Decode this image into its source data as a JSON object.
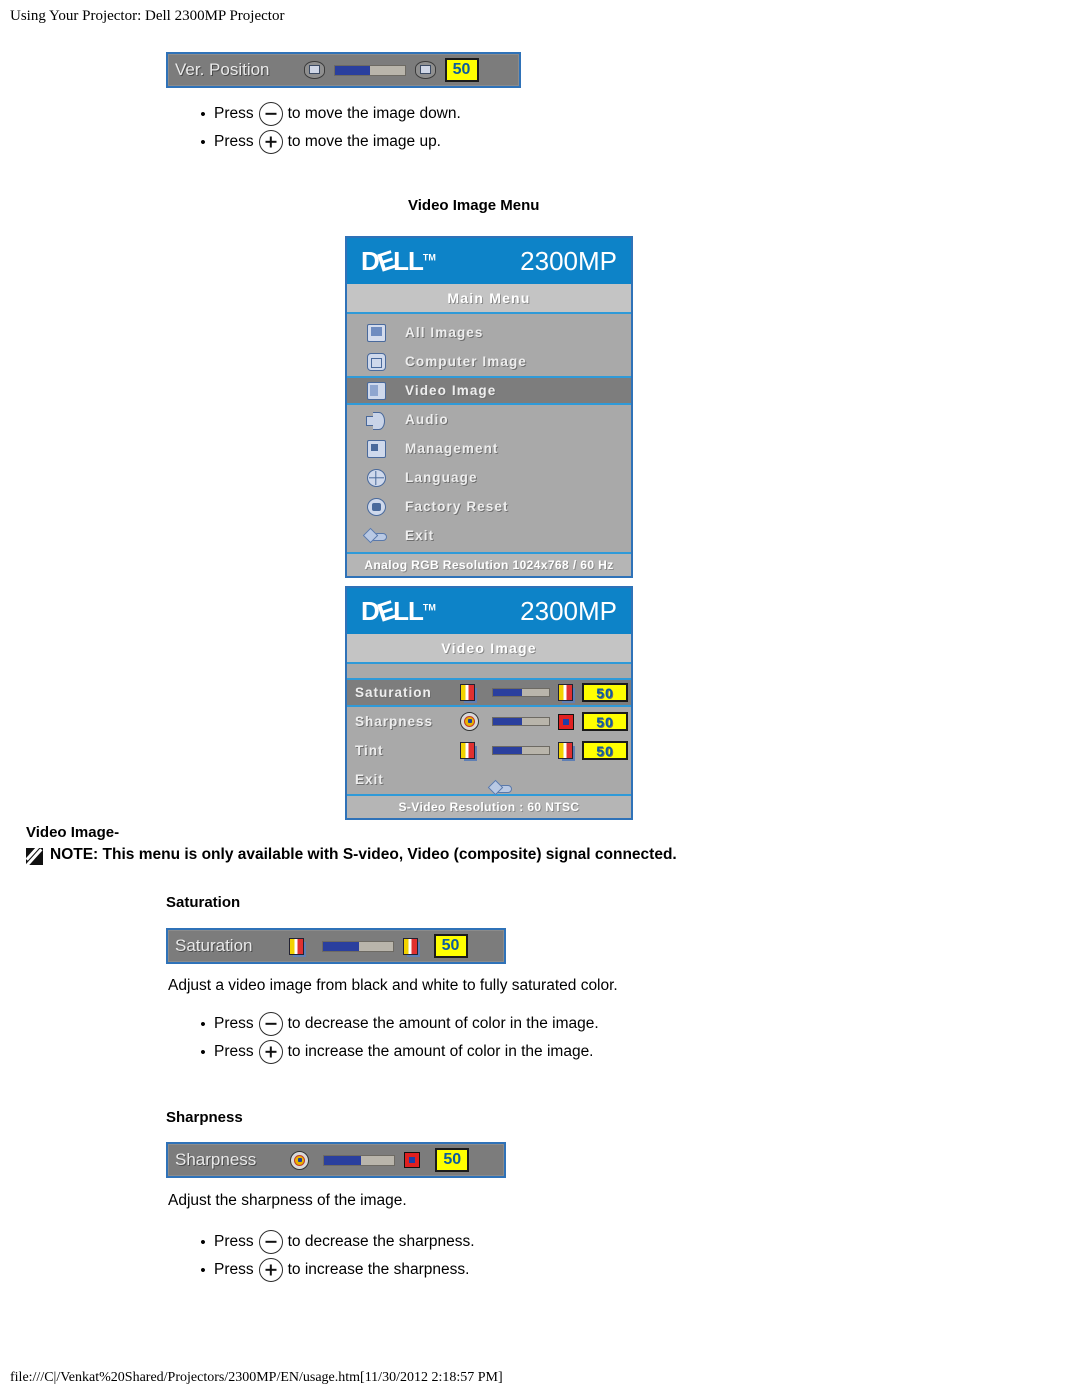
{
  "page": {
    "header": "Using Your Projector: Dell 2300MP Projector",
    "footer": "file:///C|/Venkat%20Shared/Projectors/2300MP/EN/usage.htm[11/30/2012 2:18:57 PM]"
  },
  "ver_position_bar": {
    "label": "Ver. Position",
    "value": "50",
    "fill_percent": 50,
    "left_icon": "image-down-icon",
    "right_icon": "image-up-icon"
  },
  "ver_position_bullets": [
    {
      "prefix": "Press",
      "key": "minus",
      "text": "to move the image down."
    },
    {
      "prefix": "Press",
      "key": "plus",
      "text": "to move the image up."
    }
  ],
  "video_image_menu_heading": "Video Image Menu",
  "main_menu_osd": {
    "brand": "DELL",
    "trademark": "TM",
    "model": "2300MP",
    "title": "Main Menu",
    "items": [
      {
        "label": "All Images",
        "icon": "all-images-icon",
        "selected": false
      },
      {
        "label": "Computer Image",
        "icon": "computer-image-icon",
        "selected": false
      },
      {
        "label": "Video Image",
        "icon": "video-image-icon",
        "selected": true
      },
      {
        "label": "Audio",
        "icon": "audio-icon",
        "selected": false
      },
      {
        "label": "Management",
        "icon": "management-icon",
        "selected": false
      },
      {
        "label": "Language",
        "icon": "language-icon",
        "selected": false
      },
      {
        "label": "Factory Reset",
        "icon": "factory-reset-icon",
        "selected": false
      },
      {
        "label": "Exit",
        "icon": "exit-icon",
        "selected": false
      }
    ],
    "status": "Analog RGB Resolution 1024x768 / 60 Hz"
  },
  "video_image_osd": {
    "brand": "DELL",
    "trademark": "TM",
    "model": "2300MP",
    "title": "Video Image",
    "rows": [
      {
        "label": "Saturation",
        "value": "50",
        "fill_percent": 52,
        "selected": true,
        "icon_left": "color-low-icon",
        "icon_right": "color-high-icon"
      },
      {
        "label": "Sharpness",
        "value": "50",
        "fill_percent": 52,
        "selected": false,
        "icon_left": "sharpness-low-icon",
        "icon_right": "sharpness-high-icon"
      },
      {
        "label": "Tint",
        "value": "50",
        "fill_percent": 52,
        "selected": false,
        "icon_left": "tint-low-icon",
        "icon_right": "tint-high-icon"
      }
    ],
    "exit_label": "Exit",
    "exit_icon": "exit-icon",
    "status": "S-Video Resolution : 60 NTSC"
  },
  "video_image_section": {
    "label": "Video Image-",
    "note": "NOTE: This menu is only available with S-video, Video (composite) signal connected."
  },
  "saturation_section": {
    "heading": "Saturation",
    "bar": {
      "label": "Saturation",
      "value": "50",
      "fill_percent": 52
    },
    "description": "Adjust a video image from black and white to fully saturated color.",
    "bullets": [
      {
        "prefix": "Press",
        "key": "minus",
        "text": "to decrease the amount of color in the image."
      },
      {
        "prefix": "Press",
        "key": "plus",
        "text": "to increase the amount of color in the image."
      }
    ]
  },
  "sharpness_section": {
    "heading": "Sharpness",
    "bar": {
      "label": "Sharpness",
      "value": "50",
      "fill_percent": 52
    },
    "description": "Adjust the sharpness of the image.",
    "bullets": [
      {
        "prefix": "Press",
        "key": "minus",
        "text": "to decrease the sharpness."
      },
      {
        "prefix": "Press",
        "key": "plus",
        "text": "to increase the sharpness."
      }
    ]
  },
  "colors": {
    "osd_header_blue": "#0d83c8",
    "osd_border_blue": "#2f72b8",
    "osd_body_gray": "#a9a9a9",
    "osd_selected_gray": "#7d7d7d",
    "value_yellow": "#ffff00",
    "slider_fill_blue": "#2a3f9e"
  }
}
